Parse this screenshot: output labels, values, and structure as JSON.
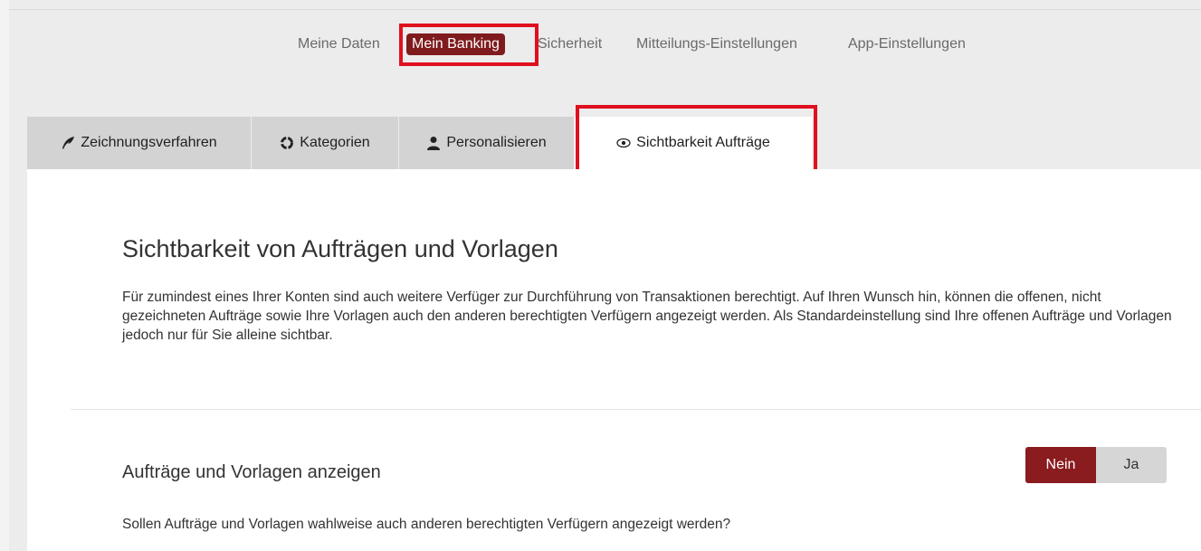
{
  "top_nav": {
    "items": [
      "Meine Daten",
      "Mein Banking",
      "Sicherheit",
      "Mitteilungs-Einstellungen",
      "App-Einstellungen"
    ],
    "active_index": 1
  },
  "sub_tabs": [
    {
      "label": "Zeichnungsverfahren",
      "icon": "feather-icon"
    },
    {
      "label": "Kategorien",
      "icon": "refresh-icon"
    },
    {
      "label": "Personalisieren",
      "icon": "user-icon"
    },
    {
      "label": "Sichtbarkeit Aufträge",
      "icon": "eye-icon",
      "active": true
    }
  ],
  "main": {
    "title": "Sichtbarkeit von Aufträgen und Vorlagen",
    "description": "Für zumindest eines Ihrer Konten sind auch weitere Verfüger zur Durchführung von Transaktionen berechtigt. Auf Ihren Wunsch hin, können die offenen, nicht gezeichneten Aufträge sowie Ihre Vorlagen auch den anderen berechtigten Verfügern angezeigt werden. Als Standardeinstellung sind Ihre offenen Aufträge und Vorlagen jedoch nur für Sie alleine sichtbar.",
    "section_title": "Aufträge und Vorlagen anzeigen",
    "toggle": {
      "no_label": "Nein",
      "yes_label": "Ja",
      "selected": "Nein"
    },
    "question": "Sollen Aufträge und Vorlagen wahlweise auch anderen berechtigten Verfügern angezeigt werden?"
  },
  "colors": {
    "accent": "#8a1b1f",
    "highlight": "#e0101e",
    "tab_inactive": "#d3d3d3",
    "background": "#ececec"
  }
}
